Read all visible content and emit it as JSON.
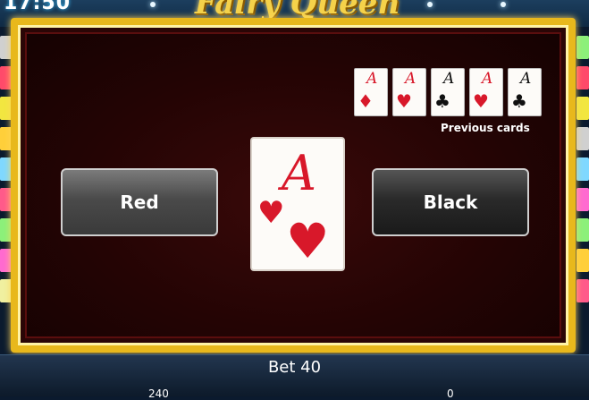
{
  "status": {
    "clock": "17:50"
  },
  "game": {
    "title": "Fairy Queen"
  },
  "gamble": {
    "red_label": "Red",
    "black_label": "Black",
    "current_card": {
      "rank": "A",
      "suit": "hearts",
      "suit_glyph": "♥",
      "color": "#d8182a"
    },
    "previous_label": "Previous cards",
    "previous_cards": [
      {
        "rank": "A",
        "suit": "diamonds",
        "glyph": "♦",
        "color": "#d8182a"
      },
      {
        "rank": "A",
        "suit": "hearts",
        "glyph": "♥",
        "color": "#d8182a"
      },
      {
        "rank": "A",
        "suit": "clubs",
        "glyph": "♣",
        "color": "#111111"
      },
      {
        "rank": "A",
        "suit": "hearts",
        "glyph": "♥",
        "color": "#d8182a"
      },
      {
        "rank": "A",
        "suit": "clubs",
        "glyph": "♣",
        "color": "#111111"
      }
    ]
  },
  "footer": {
    "bet_label": "Bet 40",
    "credit": "240",
    "win": "0"
  },
  "colors": {
    "frame_gold": "#e8b81c",
    "felt": "#2a0606",
    "red_suit": "#d8182a"
  }
}
